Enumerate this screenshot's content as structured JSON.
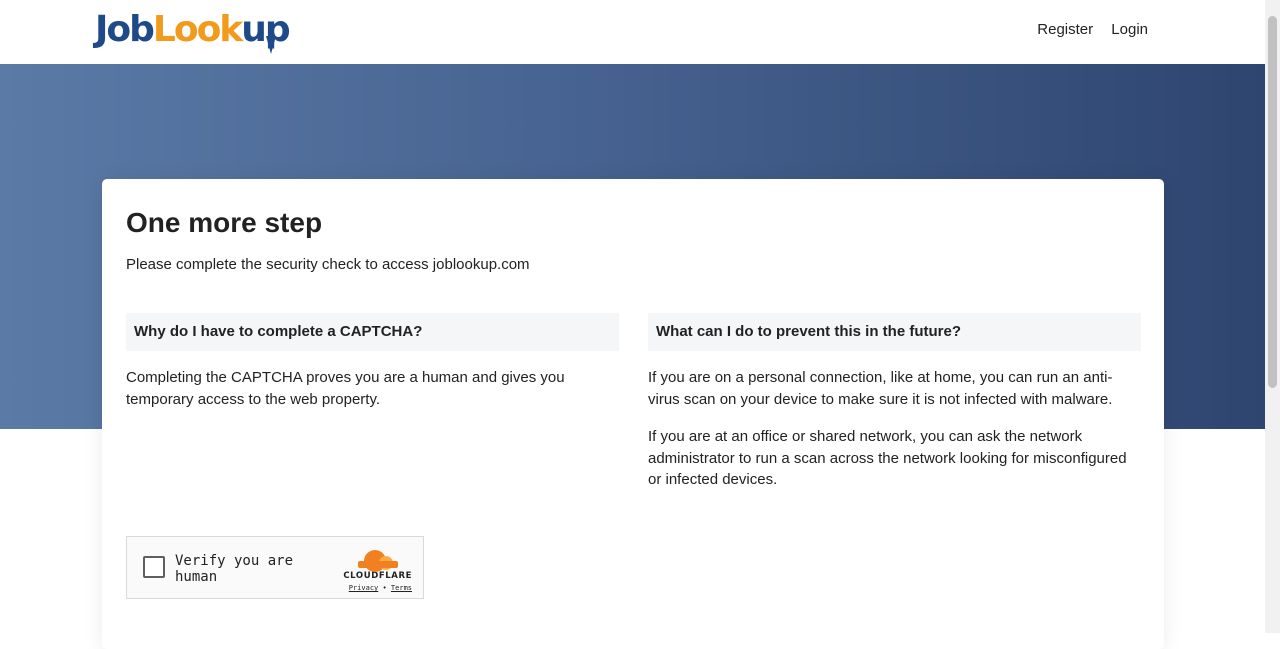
{
  "header": {
    "logo": {
      "part1": "Job",
      "part2": "Look",
      "part3": "up"
    },
    "nav": {
      "register": "Register",
      "login": "Login"
    }
  },
  "card": {
    "title": "One more step",
    "subtitle": "Please complete the security check to access joblookup.com",
    "left": {
      "question": "Why do I have to complete a CAPTCHA?",
      "answer": "Completing the CAPTCHA proves you are a human and gives you temporary access to the web property."
    },
    "right": {
      "question": "What can I do to prevent this in the future?",
      "answer1": "If you are on a personal connection, like at home, you can run an anti-virus scan on your device to make sure it is not infected with malware.",
      "answer2": "If you are at an office or shared network, you can ask the network administrator to run a scan across the network looking for misconfigured or infected devices."
    }
  },
  "captcha": {
    "label": "Verify you are human",
    "brand": "CLOUDFLARE",
    "privacy": "Privacy",
    "separator": "•",
    "terms": "Terms"
  },
  "colors": {
    "brand_blue": "#1f4a8a",
    "brand_orange": "#f29a1c",
    "hero_start": "#5b7aa6",
    "hero_end": "#2e4570",
    "cloudflare_orange": "#f38020"
  },
  "icons": [
    "cloudflare-cloud-icon",
    "logo-tie-icon"
  ]
}
